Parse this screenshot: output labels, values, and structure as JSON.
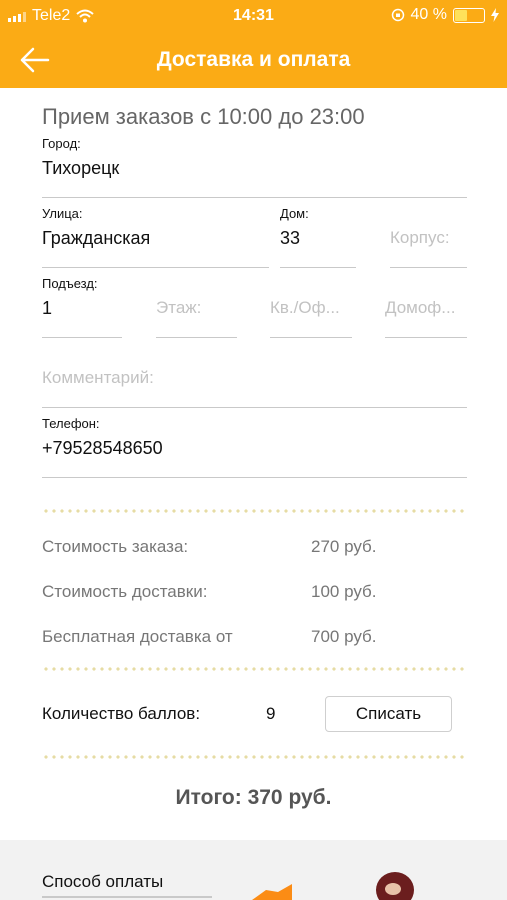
{
  "status": {
    "carrier": "Tele2",
    "time": "14:31",
    "battery": "40 %"
  },
  "header": {
    "title": "Доставка и оплата"
  },
  "hours": "Прием заказов с 10:00 до 23:00",
  "form": {
    "city": {
      "label": "Город:",
      "value": "Тихорецк"
    },
    "street": {
      "label": "Улица:",
      "value": "Гражданская"
    },
    "house": {
      "label": "Дом:",
      "value": "33"
    },
    "building": {
      "placeholder": "Корпус:"
    },
    "entrance": {
      "label": "Подъезд:",
      "value": "1"
    },
    "floor": {
      "placeholder": "Этаж:"
    },
    "apartment": {
      "placeholder": "Кв./Оф..."
    },
    "intercom": {
      "placeholder": "Домоф..."
    },
    "comment": {
      "placeholder": "Комментарий:"
    },
    "phone": {
      "label": "Телефон:",
      "value": "+79528548650"
    }
  },
  "summary": {
    "order_cost": {
      "label": "Стоимость заказа:",
      "value": "270 руб."
    },
    "delivery_cost": {
      "label": "Стоимость доставки:",
      "value": "100 руб."
    },
    "free_delivery": {
      "label": "Бесплатная доставка от",
      "value": "700 руб."
    }
  },
  "points": {
    "label": "Количество баллов:",
    "value": "9",
    "button": "Списать"
  },
  "total": "Итого:  370 руб.",
  "payment": {
    "label": "Способ оплаты"
  },
  "colors": {
    "accent": "#fbab15"
  }
}
